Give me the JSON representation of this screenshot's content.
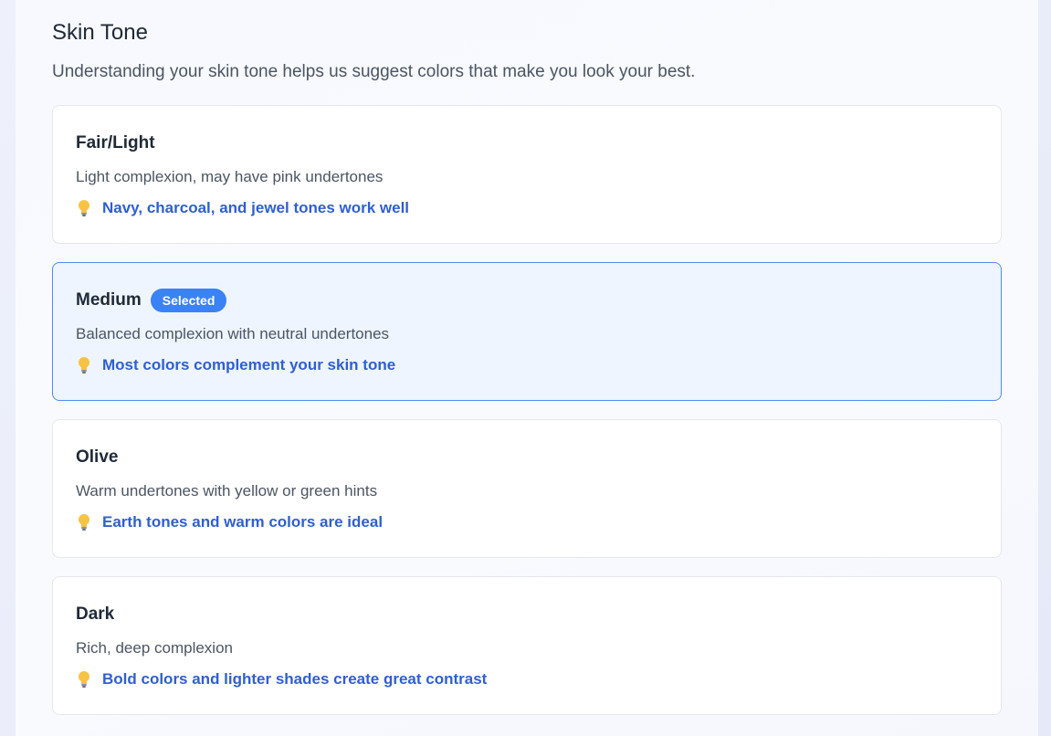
{
  "section": {
    "title": "Skin Tone",
    "description": "Understanding your skin tone helps us suggest colors that make you look your best."
  },
  "options": [
    {
      "title": "Fair/Light",
      "description": "Light complexion, may have pink undertones",
      "tip": "Navy, charcoal, and jewel tones work well",
      "selected": false
    },
    {
      "title": "Medium",
      "badge": "Selected",
      "description": "Balanced complexion with neutral undertones",
      "tip": "Most colors complement your skin tone",
      "selected": true
    },
    {
      "title": "Olive",
      "description": "Warm undertones with yellow or green hints",
      "tip": "Earth tones and warm colors are ideal",
      "selected": false
    },
    {
      "title": "Dark",
      "description": "Rich, deep complexion",
      "tip": "Bold colors and lighter shades create great contrast",
      "selected": false
    }
  ],
  "colors": {
    "accent": "#3b82f6",
    "selected_bg": "#eef5ff",
    "tip_text": "#2f5fd0"
  },
  "icons": {
    "tip": "lightbulb-icon"
  }
}
